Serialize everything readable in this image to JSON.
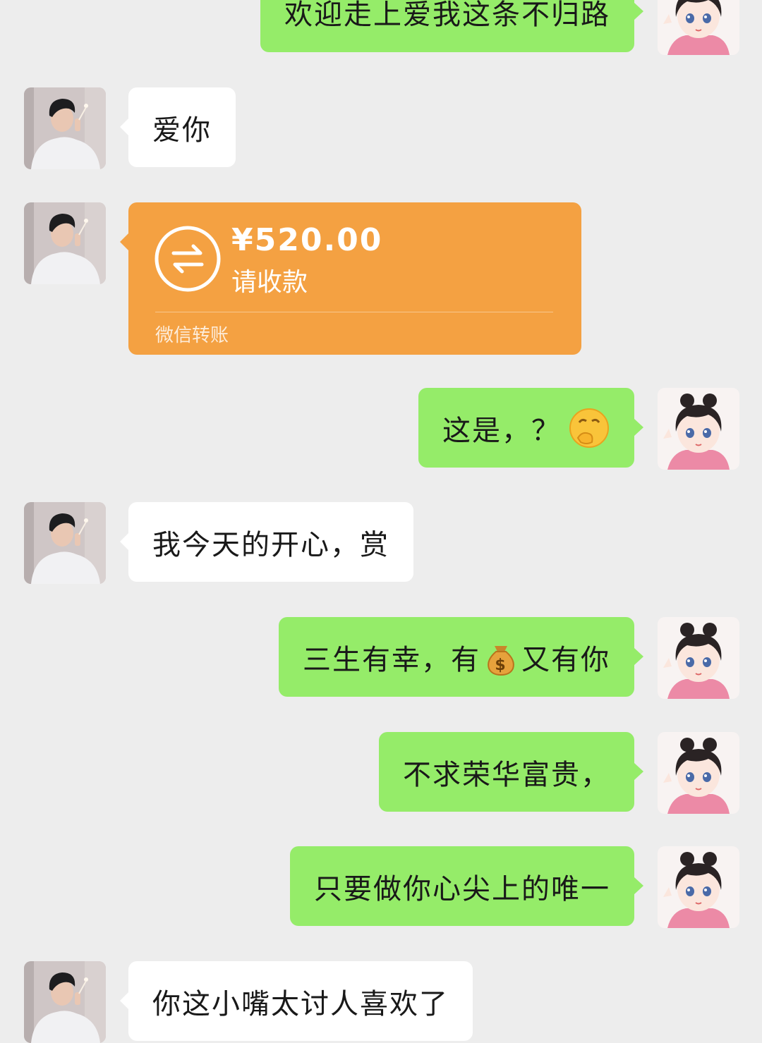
{
  "messages": [
    {
      "side": "out",
      "text": "欢迎走上爱我这条不归路"
    },
    {
      "side": "in",
      "text": "爱你"
    },
    {
      "side": "in",
      "type": "transfer",
      "amount": "¥520.00",
      "status": "请收款",
      "footer": "微信转账",
      "icon": "transfer-arrows-icon"
    },
    {
      "side": "out",
      "text": "这是，？",
      "emoji": "thinking-face-emoji"
    },
    {
      "side": "in",
      "text": "我今天的开心，赏"
    },
    {
      "side": "out",
      "text_before": "三生有幸，有",
      "emoji": "money-bag-emoji",
      "text_after": "又有你"
    },
    {
      "side": "out",
      "text": "不求荣华富贵，"
    },
    {
      "side": "out",
      "text": "只要做你心尖上的唯一"
    },
    {
      "side": "in",
      "text": "你这小嘴太讨人喜欢了"
    }
  ],
  "colors": {
    "background": "#ededed",
    "incoming_bubble": "#ffffff",
    "outgoing_bubble": "#95ec69",
    "transfer_card": "#f4a142"
  }
}
